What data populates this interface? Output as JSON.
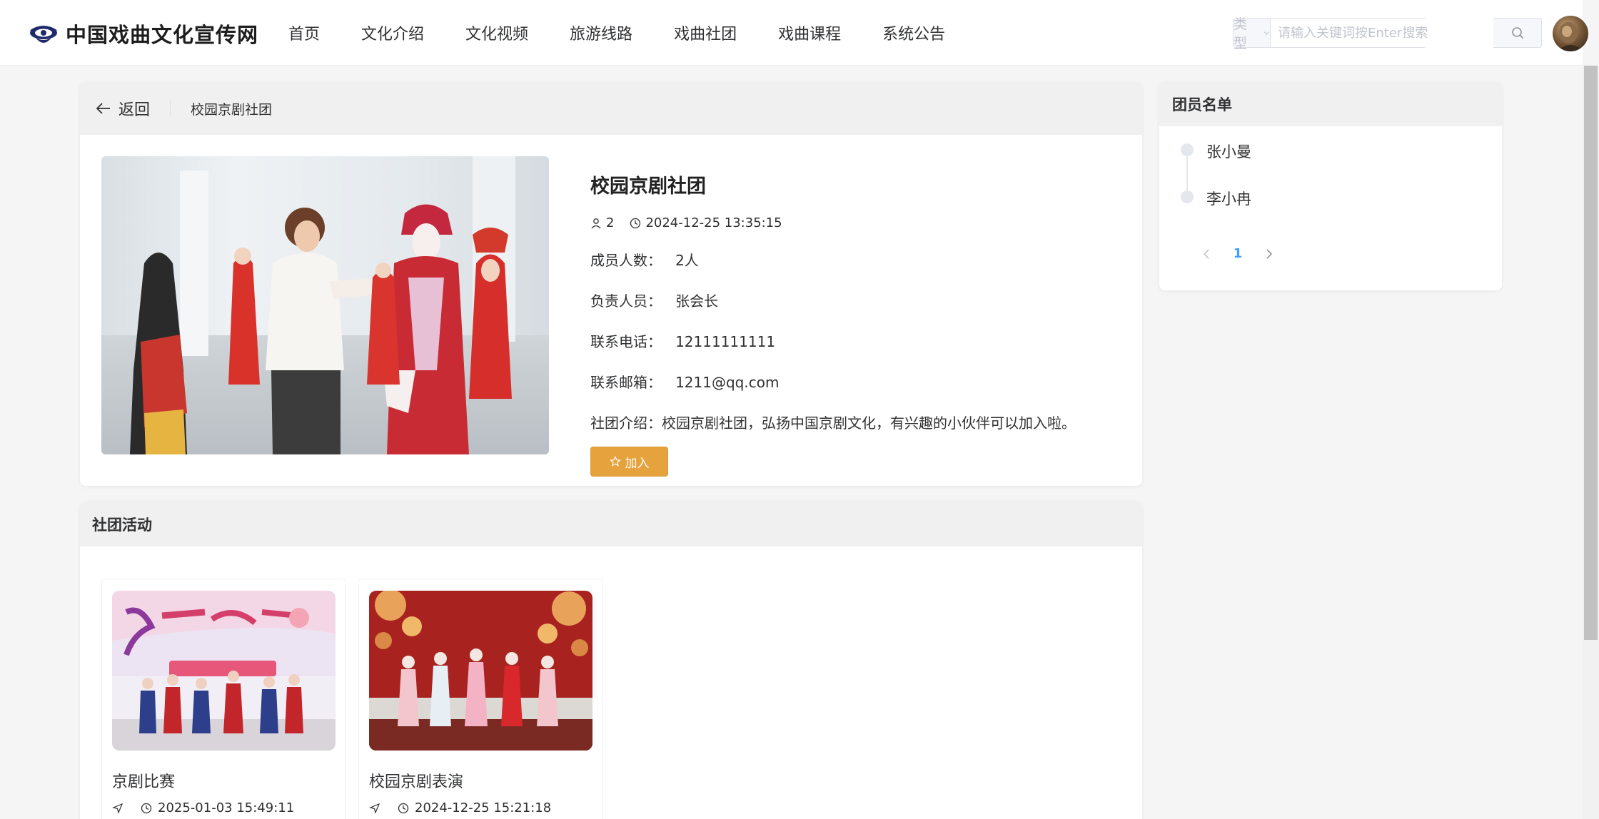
{
  "header": {
    "site_title": "中国戏曲文化宣传网",
    "nav": [
      "首页",
      "文化介绍",
      "文化视频",
      "旅游线路",
      "戏曲社团",
      "戏曲课程",
      "系统公告"
    ],
    "type_select_placeholder": "类型",
    "search_placeholder": "请输入关键词按Enter搜索"
  },
  "detail": {
    "back_label": "返回",
    "breadcrumb": "校园京剧社团",
    "title": "校园京剧社团",
    "count": "2",
    "datetime": "2024-12-25 13:35:15",
    "members_line": "成员人数：   2人",
    "leader_line": "负责人员：   张会长",
    "phone_line": "联系电话：   12111111111",
    "email_line": "联系邮箱：   1211@qq.com",
    "intro_line": "社团介绍：校园京剧社团，弘扬中国京剧文化，有兴趣的小伙伴可以加入啦。",
    "join_label": "加入"
  },
  "members": {
    "title": "团员名单",
    "items": [
      "张小曼",
      "李小冉"
    ],
    "current_page": "1"
  },
  "activities": {
    "title": "社团活动",
    "items": [
      {
        "title": "京剧比赛",
        "datetime": "2025-01-03 15:49:11"
      },
      {
        "title": "校园京剧表演",
        "datetime": "2024-12-25 15:21:18"
      }
    ]
  },
  "icons": {
    "logo": "fan-eye-logo-icon",
    "search": "search-icon",
    "back": "arrow-left-icon",
    "user": "user-icon",
    "clock": "clock-icon",
    "star": "star-icon",
    "location": "location-arrow-icon"
  },
  "colors": {
    "brand_navy": "#1e2a6b",
    "join_button": "#e6a23c",
    "pager_active": "#409eff"
  }
}
